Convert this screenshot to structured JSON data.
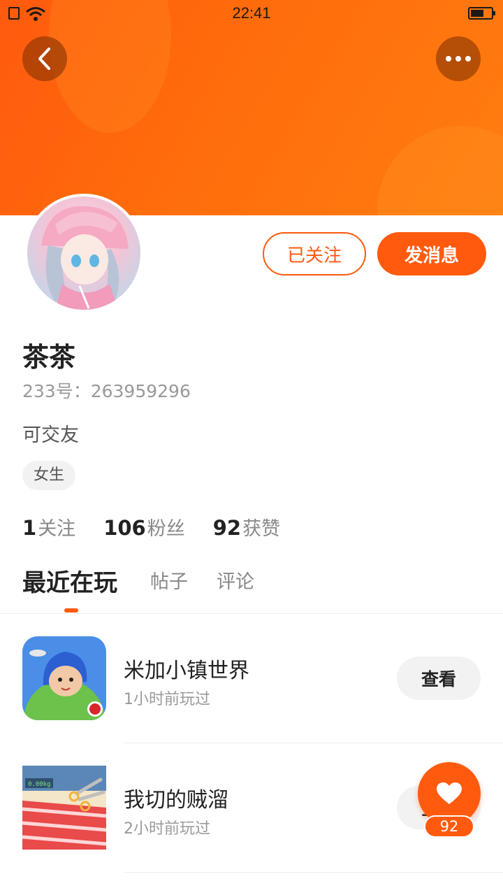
{
  "status_bar": {
    "time": "22:41"
  },
  "profile": {
    "name": "茶茶",
    "uid": "233号：263959296",
    "bio": "可交友",
    "gender_tag": "女生",
    "follow_label": "已关注",
    "message_label": "发消息"
  },
  "stats": [
    {
      "value": "1",
      "label": "关注"
    },
    {
      "value": "106",
      "label": "粉丝"
    },
    {
      "value": "92",
      "label": "获赞"
    }
  ],
  "tabs": [
    {
      "label": "最近在玩",
      "active": true
    },
    {
      "label": "帖子",
      "active": false
    },
    {
      "label": "评论",
      "active": false
    }
  ],
  "games": [
    {
      "title": "米加小镇世界",
      "played": "1小时前玩过",
      "button": "查看"
    },
    {
      "title": "我切的贼溜",
      "played": "2小时前玩过",
      "button": "查看"
    }
  ],
  "game_icon_texts": {
    "scale_readout": "0.00kg"
  },
  "like_fab": {
    "count": "92"
  },
  "colors": {
    "accent": "#ff5a0e",
    "header_gradient_end": "#ff7d10"
  },
  "icons": {
    "back": "chevron-left-icon",
    "more": "more-dots-icon",
    "like": "heart-icon"
  }
}
